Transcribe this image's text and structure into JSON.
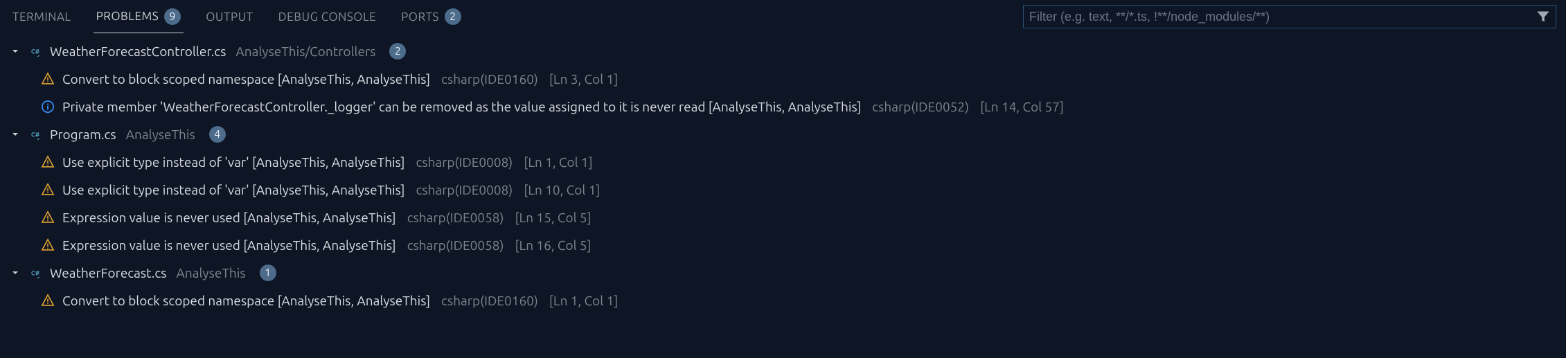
{
  "tabs": [
    {
      "label": "TERMINAL",
      "badge": null,
      "active": false
    },
    {
      "label": "PROBLEMS",
      "badge": "9",
      "active": true
    },
    {
      "label": "OUTPUT",
      "badge": null,
      "active": false
    },
    {
      "label": "DEBUG CONSOLE",
      "badge": null,
      "active": false
    },
    {
      "label": "PORTS",
      "badge": "2",
      "active": false
    }
  ],
  "filter": {
    "placeholder": "Filter (e.g. text, **/*.ts, !**/node_modules/**)"
  },
  "files": [
    {
      "name": "WeatherForecastController.cs",
      "path": "AnalyseThis/Controllers",
      "badge": "2",
      "problems": [
        {
          "severity": "warning",
          "message": "Convert to block scoped namespace [AnalyseThis, AnalyseThis]",
          "code": "csharp(IDE0160)",
          "location": "[Ln 3, Col 1]"
        },
        {
          "severity": "info",
          "message": "Private member 'WeatherForecastController._logger' can be removed as the value assigned to it is never read [AnalyseThis, AnalyseThis]",
          "code": "csharp(IDE0052)",
          "location": "[Ln 14, Col 57]"
        }
      ]
    },
    {
      "name": "Program.cs",
      "path": "AnalyseThis",
      "badge": "4",
      "problems": [
        {
          "severity": "warning",
          "message": "Use explicit type instead of 'var' [AnalyseThis, AnalyseThis]",
          "code": "csharp(IDE0008)",
          "location": "[Ln 1, Col 1]"
        },
        {
          "severity": "warning",
          "message": "Use explicit type instead of 'var' [AnalyseThis, AnalyseThis]",
          "code": "csharp(IDE0008)",
          "location": "[Ln 10, Col 1]"
        },
        {
          "severity": "warning",
          "message": "Expression value is never used [AnalyseThis, AnalyseThis]",
          "code": "csharp(IDE0058)",
          "location": "[Ln 15, Col 5]"
        },
        {
          "severity": "warning",
          "message": "Expression value is never used [AnalyseThis, AnalyseThis]",
          "code": "csharp(IDE0058)",
          "location": "[Ln 16, Col 5]"
        }
      ]
    },
    {
      "name": "WeatherForecast.cs",
      "path": "AnalyseThis",
      "badge": "1",
      "problems": [
        {
          "severity": "warning",
          "message": "Convert to block scoped namespace [AnalyseThis, AnalyseThis]",
          "code": "csharp(IDE0160)",
          "location": "[Ln 1, Col 1]"
        }
      ]
    }
  ]
}
